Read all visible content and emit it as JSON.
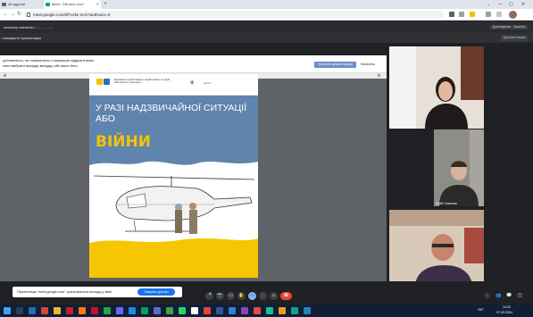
{
  "browser": {
    "tabs": [
      {
        "label": "ай адрани",
        "active": false
      },
      {
        "label": "Meet: \"eff-xzkv-ncm\"",
        "active": true
      }
    ],
    "new_tab": "+",
    "window_controls": [
      "⌄",
      "—",
      "▢",
      "✕"
    ],
    "url": "meet.google.com/eff-xzkv-ncm?authuser=0",
    "back": "←",
    "forward": "→",
    "reload": "↻"
  },
  "notices": {
    "top": "спочатку натисніть  ',  ',  ,  , ,  ,  :  ,  ,",
    "top_btn1": "Доповідачем",
    "top_btn2": "Закрити",
    "second": "і показуєте презентацію",
    "second_btn": "Зупинити показ"
  },
  "presentation": {
    "line1": "рублюються, не помилитеся з помилкою відкрити вікно",
    "line2": "лася вибрати вкладку вкладку або вікно його.",
    "share_button": "Зупинити демонстрацію",
    "right_text": "Натисніть"
  },
  "document": {
    "org": "Державна служба України з надзвичайних ситуацій, міністерство, організація",
    "trident": "⚜",
    "emblem": "ДСНС",
    "title": "У РАЗІ НАДЗВИЧАЙНОЇ СИТУАЦІЇ АБО",
    "title_emph": "ВІЙНИ"
  },
  "participants": [
    {
      "name": "",
      "role": "girl"
    },
    {
      "name": "Юрій Семенов",
      "role": "boy"
    },
    {
      "name": "",
      "role": "man"
    }
  ],
  "popup": {
    "text": "Презентація \"meet.google.com\" транслюється вкладці у вікні.",
    "primary": "Закрити доступ",
    "cancel": "Сховати"
  },
  "controls": {
    "icons": [
      "🎤",
      "📷",
      "▭",
      "✋",
      "⋮",
      "☎"
    ],
    "right": [
      "ⓘ",
      "👥",
      "💬",
      "◫"
    ]
  },
  "taskbar": {
    "time": "14:02",
    "date": "07.03.2024",
    "lang": "УКР"
  },
  "colors": {
    "doc_blue": "#5f84ad",
    "doc_yellow": "#f6c603",
    "accent": "#1a73e8",
    "end_call": "#ea4335"
  }
}
